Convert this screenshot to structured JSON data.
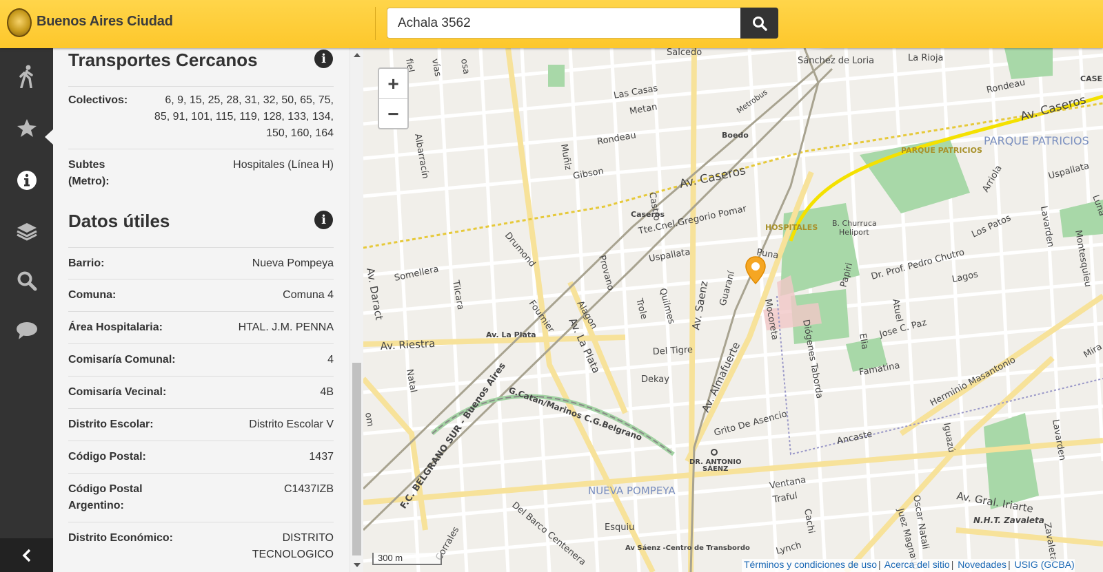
{
  "header": {
    "brand": "Buenos Aires Ciudad",
    "search_value": "Achala 3562",
    "search_icon": "search-icon"
  },
  "nav": {
    "items": [
      {
        "name": "walking-icon"
      },
      {
        "name": "star-icon"
      },
      {
        "name": "info-icon"
      },
      {
        "name": "layers-icon"
      },
      {
        "name": "search-icon"
      },
      {
        "name": "chat-icon"
      }
    ],
    "active_index": 2,
    "collapse_icon": "chevron-left-icon"
  },
  "panel": {
    "transportes": {
      "title": "Transportes Cercanos",
      "rows": [
        {
          "key": "Colectivos:",
          "value_lines": [
            "6, 9, 15, 25, 28, 31, 32, 50, 65, 75,",
            "85, 91, 101, 115, 119, 128, 133, 134,",
            "150, 160, 164"
          ]
        },
        {
          "key_lines": [
            "Subtes",
            "(Metro):"
          ],
          "value": "Hospitales (Línea H)"
        }
      ]
    },
    "datos": {
      "title": "Datos útiles",
      "rows": [
        {
          "key": "Barrio:",
          "value": "Nueva Pompeya"
        },
        {
          "key": "Comuna:",
          "value": "Comuna 4"
        },
        {
          "key": "Área Hospitalaria:",
          "value": "HTAL. J.M. PENNA"
        },
        {
          "key": "Comisaría Comunal:",
          "value": "4"
        },
        {
          "key": "Comisaría Vecinal:",
          "value": "4B"
        },
        {
          "key": "Distrito Escolar:",
          "value": "Distrito Escolar V"
        },
        {
          "key": "Código Postal:",
          "value": "1437"
        },
        {
          "key_lines": [
            "Código Postal",
            "Argentino:"
          ],
          "value": "C1437IZB"
        },
        {
          "key": "Distrito Económico:",
          "value_lines": [
            "DISTRITO",
            "TECNOLOGICO"
          ]
        }
      ]
    }
  },
  "map": {
    "zoom_in": "+",
    "zoom_out": "−",
    "scale": "300 m",
    "footer_links": [
      "Términos y condiciones de uso",
      "Acerca del sitio",
      "Novedades",
      "USIG (GCBA)"
    ],
    "labels": {
      "salcedo": "Salcedo",
      "sanchez_de_loria": "Sánchez de Loria",
      "la_rioja": "La Rioja",
      "rondeau_ne": "Rondeau",
      "caseros_ne": "CASE",
      "las_casas": "Las Casas",
      "metan": "Metan",
      "metrobus": "Metrobus",
      "boedo": "Boedo",
      "av_caseros_ne": "Av. Caseros",
      "parque_patricios_big": "PARQUE PATRICIOS",
      "parque_patricios_small": "PARQUE PATRICIOS",
      "rondeau": "Rondeau",
      "gibson": "Gibson",
      "castro": "Castro",
      "muniz": "Muñiz",
      "albarracin": "Albarracín",
      "av_caseros": "Av. Caseros",
      "arriola": "Arriola",
      "uspallata_e": "Uspallata",
      "caseros_st": "Caseros",
      "gregorio_pomar": "Tte.Cnel.Gregorio Pomar",
      "hospitales": "HOSPITALES",
      "churruca": "B. Churruca",
      "heliport": "Heliport",
      "los_patos": "Los Patos",
      "lavarden": "Lavarden",
      "montesquieu": "Montesquieu",
      "luna": "Luna",
      "puna": "Puna",
      "drumond": "Drumond",
      "uspallata": "Uspallata",
      "somellera": "Somellera",
      "av_daract": "Av. Daract",
      "provano": "Provano",
      "pedro_chutro": "Dr. Prof. Pedro Chutro",
      "lagos": "Lagos",
      "guarani": "Guaraní",
      "papiri": "Papiri",
      "tilcara": "Tilcara",
      "fournier": "Fournier",
      "alagon": "Alagon",
      "quilmes": "Quilmes",
      "trole": "Trole",
      "av_saenz": "Av. Saenz",
      "mocoreta": "Mocoreta",
      "diogenes_taborda": "Diógenes Taborda",
      "atuel": "Atuel",
      "elia": "Elia",
      "jose_c_paz": "Jose C. Paz",
      "av_riestra": "Av. Riestra",
      "av_la_plata_small": "Av. La Plata",
      "av_la_plata": "Av. La Plata",
      "del_tigre": "Del Tigre",
      "dekay": "Dekay",
      "av_almafuerte": "Av. Almafuerte",
      "famatina": "Famatina",
      "herminio_masantonio": "Herminio Masantonio",
      "mira": "Mira",
      "natal": "Natal",
      "belgrano_sur": "F.C. BELGRANO SUR - Buenos Aires",
      "catan": "G.Catán/Marinos C.G.Belgrano",
      "grito_de_asencio": "Grito De Asencio",
      "ancaste": "Ancaste",
      "iguazu": "Iguazú",
      "lavarden_s": "Lavarden",
      "antonio_saenz": "DR. ANTONIO",
      "antonio_saenz2": "SÁENZ",
      "nueva_pompeya": "NUEVA POMPEYA",
      "ventana": "Ventana",
      "traful": "Traful",
      "cachi": "Cachi",
      "del_barco_centenera": "Del Barco Centenera",
      "esquiu": "Esquiu",
      "av_saenz_centro": "Av Sáenz -Centro de Transbordo",
      "lynch": "Lynch",
      "juez_magnaud": "Juez Magnaud",
      "oscar_natali": "Oscar Natali",
      "av_gral_iriarte": "Av. Gral. Iriarte",
      "nht_zavaleta": "N.H.T. Zavaleta",
      "zavaleta": "Zavaleta",
      "corrales": "Corrales",
      "om": "om",
      "fiel": "fiel",
      "vias": "vías",
      "osa": "osa"
    }
  },
  "colors": {
    "header_yellow": "#fdc72b",
    "nav_dark": "#333333",
    "park_green": "#a5d6a7",
    "marker_orange": "#f5a623"
  }
}
